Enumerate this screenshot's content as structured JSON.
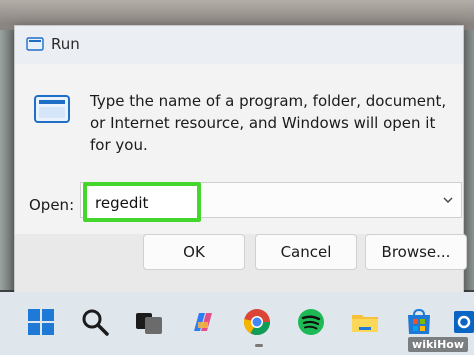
{
  "dialog": {
    "title": "Run",
    "description": "Type the name of a program, folder, document, or Internet resource, and Windows will open it for you.",
    "open_label": "Open:",
    "open_value": "regedit",
    "buttons": {
      "ok": "OK",
      "cancel": "Cancel",
      "browse": "Browse..."
    }
  },
  "taskbar": {
    "icons": [
      "windows-start-icon",
      "search-icon",
      "task-view-icon",
      "copilot-icon",
      "chrome-icon",
      "spotify-icon",
      "file-explorer-icon",
      "microsoft-store-icon",
      "outlook-icon"
    ]
  },
  "watermark": "wikiHow",
  "colors": {
    "highlight": "#44d62c",
    "dialog_bg": "#f3f3f3",
    "taskbar_bg": "#dfe6ec"
  }
}
